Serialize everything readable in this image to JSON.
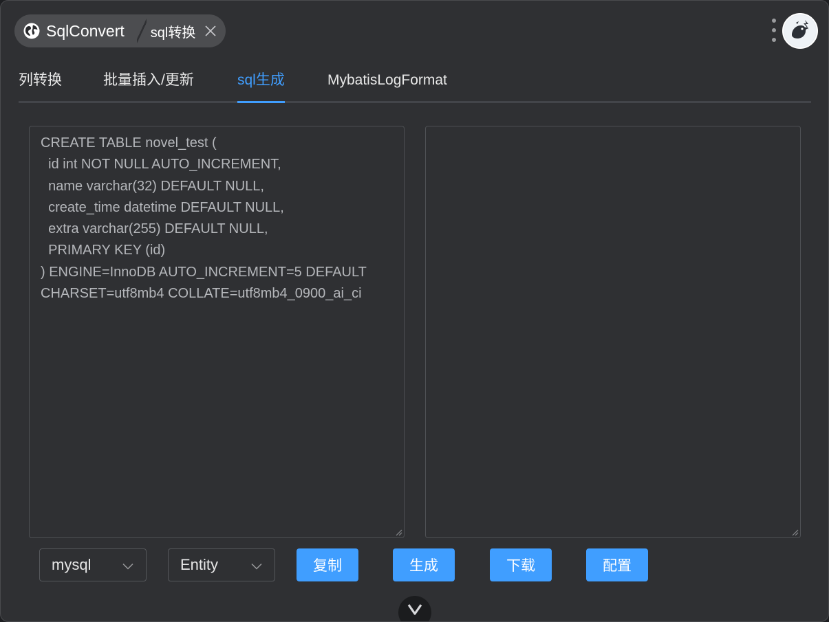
{
  "header": {
    "app_name": "SqlConvert",
    "tab_name": "sql转换"
  },
  "tabs": [
    {
      "label": "列转换"
    },
    {
      "label": "批量插入/更新"
    },
    {
      "label": "sql生成",
      "active": true
    },
    {
      "label": "MybatisLogFormat"
    }
  ],
  "editor": {
    "input_text": "CREATE TABLE novel_test (\n  id int NOT NULL AUTO_INCREMENT,\n  name varchar(32) DEFAULT NULL,\n  create_time datetime DEFAULT NULL,\n  extra varchar(255) DEFAULT NULL,\n  PRIMARY KEY (id)\n) ENGINE=InnoDB AUTO_INCREMENT=5 DEFAULT CHARSET=utf8mb4 COLLATE=utf8mb4_0900_ai_ci",
    "output_text": ""
  },
  "controls": {
    "db_select": "mysql",
    "type_select": "Entity",
    "copy_label": "复制",
    "generate_label": "生成",
    "download_label": "下载",
    "config_label": "配置"
  },
  "colors": {
    "accent": "#409eff",
    "background": "#2f3033",
    "text": "#e8e8e8"
  },
  "icons": {
    "app": "globe-icon",
    "tab_close": "close-icon",
    "menu": "more-vertical-icon",
    "logo": "app-logo-icon",
    "dropdown": "chevron-down-icon",
    "collapse": "chevron-down-icon"
  }
}
